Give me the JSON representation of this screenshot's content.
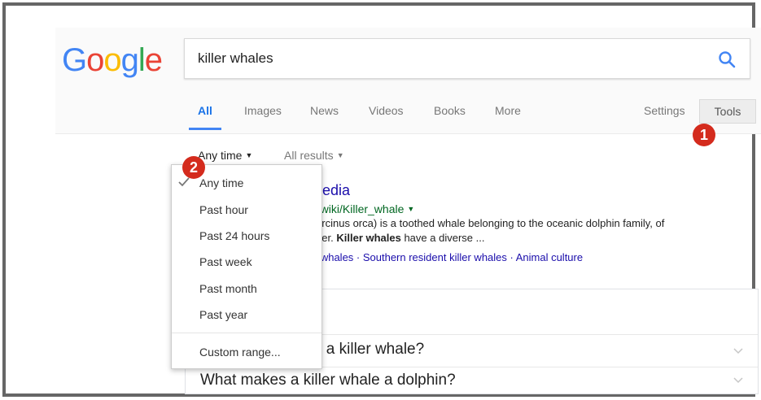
{
  "logo": {
    "letters": [
      "G",
      "o",
      "o",
      "g",
      "l",
      "e"
    ]
  },
  "search": {
    "value": "killer whales",
    "icon": "search-icon"
  },
  "tabs": [
    {
      "label": "All",
      "active": true
    },
    {
      "label": "Images"
    },
    {
      "label": "News"
    },
    {
      "label": "Videos"
    },
    {
      "label": "Books"
    },
    {
      "label": "More"
    }
  ],
  "settings_label": "Settings",
  "tools_label": "Tools",
  "badges": [
    "1",
    "2"
  ],
  "filters": {
    "time": "Any time",
    "results": "All results"
  },
  "time_menu": {
    "items": [
      "Any time",
      "Past hour",
      "Past 24 hours",
      "Past week",
      "Past month",
      "Past year"
    ],
    "custom": "Custom range...",
    "selected_index": 0
  },
  "result": {
    "title": "ipedia",
    "url": "g/wiki/Killer_whale",
    "snippet_1": "a (Orcinus orca) is a toothed whale belonging to the oceanic dolphin family, of",
    "snippet_2_pre": "ember. ",
    "snippet_2_bold": "Killer whales",
    "snippet_2_post": " have a diverse ...",
    "links": "iller whales · Southern resident killer whales · Animal culture"
  },
  "paa": {
    "header_fragment": "k",
    "questions": [
      "it a killer whale?",
      "What makes a killer whale a dolphin?"
    ]
  },
  "colors": {
    "accent": "#4285f4",
    "badge": "#d42b1d",
    "link": "#1a0dab",
    "url": "#006621"
  }
}
